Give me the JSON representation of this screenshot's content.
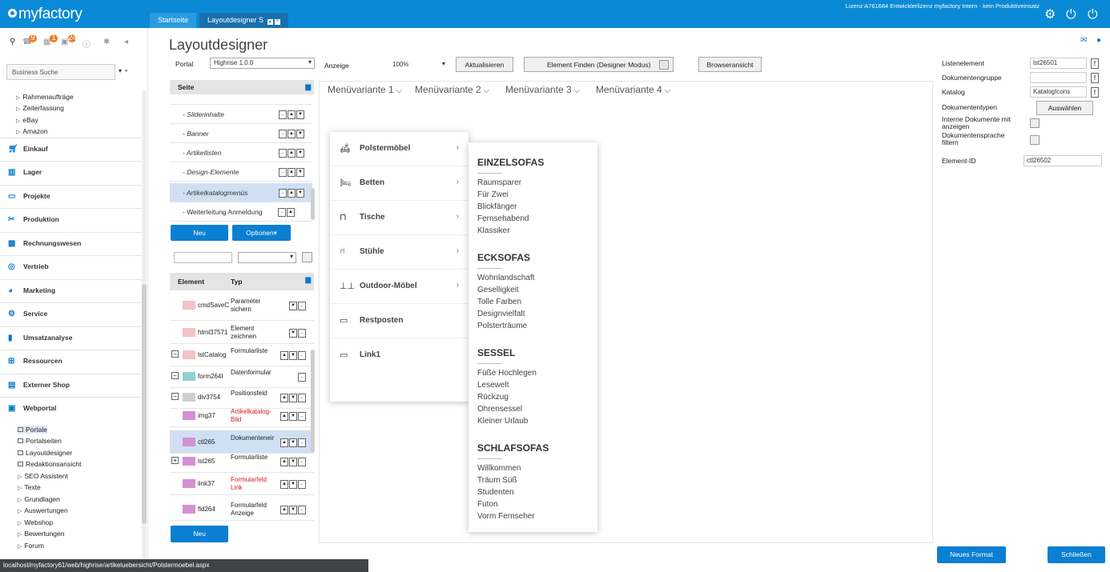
{
  "brand": "myfactory",
  "license_text": "Lizenz A761684 Entwicklerlizenz myfactory Intern - kein Produktiveinsatz",
  "tabs": [
    {
      "label": "Startseite"
    },
    {
      "label": "Layoutdesigner S"
    }
  ],
  "sidebar": {
    "badges": [
      "9",
      "1",
      "24"
    ],
    "search_placeholder": "Business Suche",
    "top_items": [
      "Rahmenaufträge",
      "Zeiterfassung",
      "eBay",
      "Amazon"
    ],
    "sections": [
      "Einkauf",
      "Lager",
      "Projekte",
      "Produktion",
      "Rechnungswesen",
      "Vertrieb",
      "Marketing",
      "Service",
      "Umsatzanalyse",
      "Ressourcen",
      "Externer Shop",
      "Webportal"
    ],
    "webportal_items": [
      "Portale",
      "Portalseiten",
      "Layoutdesigner",
      "Redaktionsansicht",
      "SEO Assistent",
      "Texte",
      "Grundlagen",
      "Auswertungen",
      "Webshop",
      "Bewertungen",
      "Forum"
    ]
  },
  "status_url": "localhost/myfactory61/web/highrise/artikeluebersicht/Polstermoebel.aspx",
  "page": {
    "title": "Layoutdesigner",
    "portal_label": "Portal",
    "portal_value": "Highrise 1.0.0",
    "anzeige_label": "Anzeige",
    "zoom_value": "100%",
    "btn_refresh": "Aktualisieren",
    "btn_find": "Element Finden (Designer Modus)",
    "btn_browser": "Browseransicht"
  },
  "pages_panel": {
    "header": "Seite",
    "rows": [
      "- Sliderinhalte",
      "- Banner",
      "- Artikellisten",
      "- Design-Elemente",
      "- Artikelkatalogmenüs",
      "- Weiterleitung Anmeldung"
    ],
    "btn_new": "Neu",
    "btn_options": "Optionen"
  },
  "elements_panel": {
    "col_element": "Element",
    "col_type": "Typ",
    "rows": [
      {
        "name": "cmdSaveC",
        "type": "Parameter sichern",
        "color": "#f4c2c2",
        "red": false
      },
      {
        "name": "html37571",
        "type": "Element zeichnen",
        "color": "#f4c2c2",
        "red": false
      },
      {
        "name": "lstCatalog",
        "type": "Formularliste",
        "color": "#f4c2c2",
        "red": false
      },
      {
        "name": "form264I",
        "type": "Datenformular",
        "color": "#8fd1cf",
        "red": false
      },
      {
        "name": "div3754",
        "type": "Positionsfeld",
        "color": "#cfcfcf",
        "red": false
      },
      {
        "name": "img37",
        "type": "Artikelkatalog-Bild",
        "color": "#d58fd3",
        "red": true
      },
      {
        "name": "ctl265",
        "type": "Dokumenteneir",
        "color": "#d58fd3",
        "red": false
      },
      {
        "name": "lst265",
        "type": "Formularliste",
        "color": "#d58fd3",
        "red": false
      },
      {
        "name": "link37",
        "type": "Formularfeld Link",
        "color": "#d58fd3",
        "red": true
      },
      {
        "name": "fld264",
        "type": "Formularfeld Anzeige",
        "color": "#d58fd3",
        "red": false
      }
    ],
    "btn_new": "Neu"
  },
  "canvas": {
    "menu_variants": [
      "Menüvariante 1",
      "Menüvariante 2",
      "Menüvariante 3",
      "Menüvariante 4"
    ],
    "categories": [
      "Polstermöbel",
      "Betten",
      "Tische",
      "Stühle",
      "Outdoor-Möbel",
      "Restposten",
      "Link1"
    ],
    "groups": [
      {
        "title": "EINZELSOFAS",
        "items": [
          "Raumsparer",
          "Für Zwei",
          "Blickfänger",
          "Fernsehabend",
          "Klassiker"
        ]
      },
      {
        "title": "ECKSOFAS",
        "items": [
          "Wohnlandschaft",
          "Geselligkeit",
          "Tolle Farben",
          "Designvielfalt",
          "Polsterträume"
        ]
      },
      {
        "title": "SESSEL",
        "items": [
          "Füße Hochlegen",
          "Lesewelt",
          "Rückzug",
          "Ohrensessel",
          "Kleiner Urlaub"
        ]
      },
      {
        "title": "SCHLAFSOFAS",
        "items": [
          "Willkommen",
          "Träum Süß",
          "Studenten",
          "Futon",
          "Vorm Fernseher"
        ]
      }
    ]
  },
  "props": {
    "listenelement_label": "Listenelement",
    "listenelement_value": "lst26501",
    "dokgruppe_label": "Dokumentengruppe",
    "katalog_label": "Katalog",
    "katalog_value": "KatalogIcons",
    "doktypen_label": "Dokumententypen",
    "btn_select": "Auswählen",
    "intern_label": "Interne Dokumente mit anzeigen",
    "sprache_label": "Dokumentensprache filtern",
    "elementid_label": "Element-ID",
    "elementid_value": "ctl26502"
  },
  "footer": {
    "btn_new_format": "Neues Format",
    "btn_close": "Schließen"
  }
}
